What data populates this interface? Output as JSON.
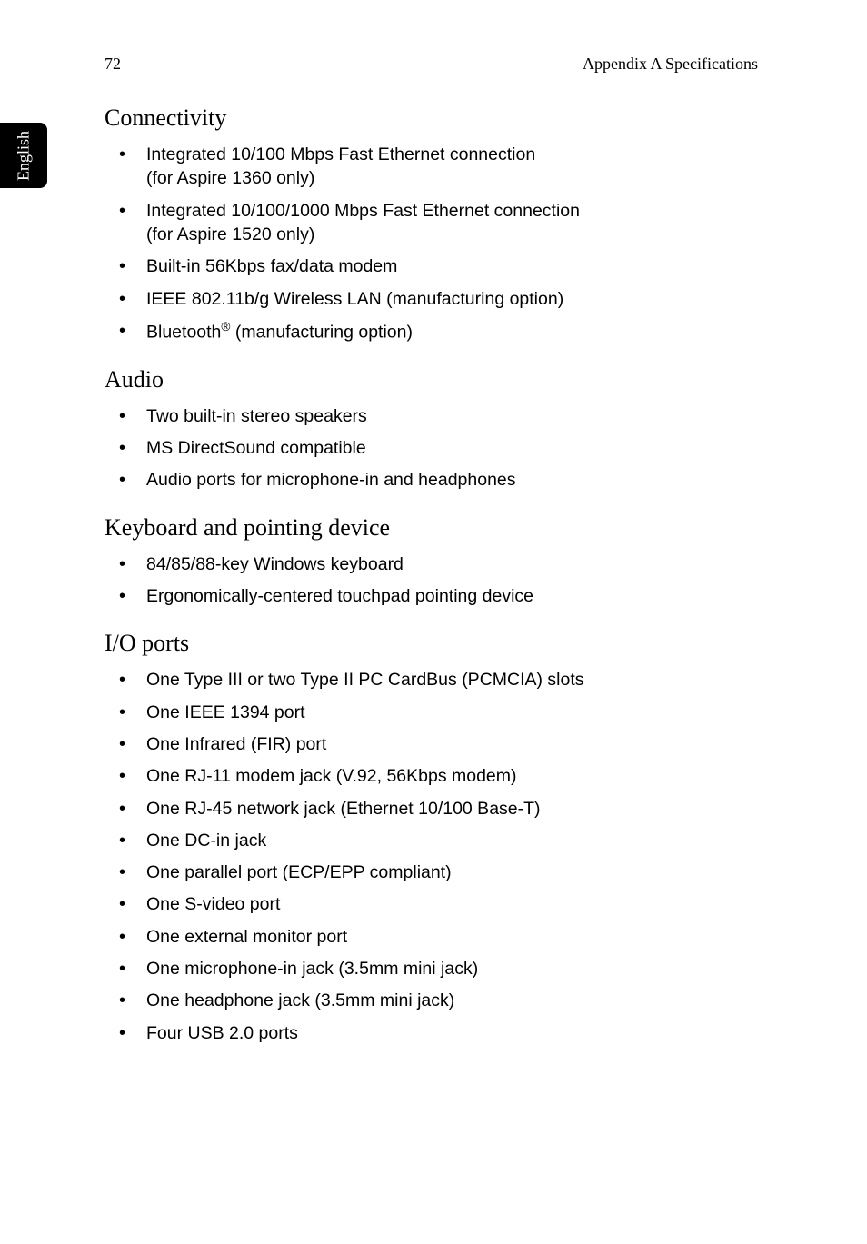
{
  "page_number": "72",
  "header_text": "Appendix A Specifications",
  "side_tab": "English",
  "sections": {
    "connectivity": {
      "heading": "Connectivity",
      "items": {
        "i0a": "Integrated 10/100 Mbps Fast Ethernet connection",
        "i0b": "(for Aspire 1360 only)",
        "i1a": "Integrated 10/100/1000 Mbps Fast Ethernet connection",
        "i1b": "(for Aspire 1520 only)",
        "i2": "Built-in 56Kbps fax/data modem",
        "i3": "IEEE 802.11b/g Wireless LAN (manufacturing option)",
        "i4a": "Bluetooth",
        "i4sup": "®",
        "i4b": " (manufacturing option)"
      }
    },
    "audio": {
      "heading": "Audio",
      "items": {
        "i0": "Two built-in stereo speakers",
        "i1": "MS DirectSound compatible",
        "i2": "Audio ports for microphone-in and headphones"
      }
    },
    "keyboard": {
      "heading": "Keyboard and pointing device",
      "items": {
        "i0": "84/85/88-key Windows keyboard",
        "i1": "Ergonomically-centered touchpad pointing device"
      }
    },
    "ioports": {
      "heading": "I/O ports",
      "items": {
        "i0": "One Type III or two Type II PC CardBus (PCMCIA) slots",
        "i1": "One IEEE 1394 port",
        "i2": "One Infrared (FIR) port",
        "i3": "One RJ-11 modem jack (V.92, 56Kbps modem)",
        "i4": "One RJ-45 network jack (Ethernet 10/100 Base-T)",
        "i5": "One DC-in jack",
        "i6": "One parallel port (ECP/EPP compliant)",
        "i7": "One S-video port",
        "i8": "One external monitor port",
        "i9": "One microphone-in jack (3.5mm mini jack)",
        "i10": "One headphone jack (3.5mm mini jack)",
        "i11": "Four USB 2.0 ports"
      }
    }
  }
}
